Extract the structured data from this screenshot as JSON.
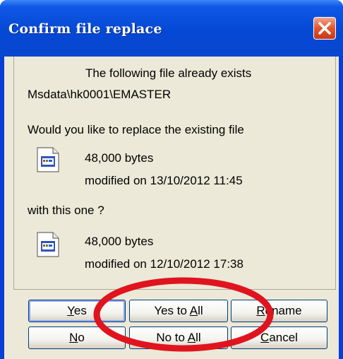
{
  "window": {
    "title": "Confirm file replace"
  },
  "message": {
    "line1": "The following file already exists",
    "path": "Msdata\\hk0001\\EMASTER",
    "question": "Would you like to replace the existing file",
    "with_label": "with this one ?"
  },
  "existing_file": {
    "size": "48,000 bytes",
    "modified": "modified on 13/10/2012 11:45"
  },
  "new_file": {
    "size": "48,000 bytes",
    "modified": "modified on 12/10/2012 17:38"
  },
  "buttons": {
    "yes": {
      "pre": "",
      "key": "Y",
      "post": "es"
    },
    "yes_to_all": {
      "pre": "Yes to ",
      "key": "A",
      "post": "ll"
    },
    "rename": {
      "pre": "",
      "key": "R",
      "post": "ename"
    },
    "no": {
      "pre": "",
      "key": "N",
      "post": "o"
    },
    "no_to_all": {
      "pre": "No to ",
      "key": "A",
      "post": "ll"
    },
    "cancel": {
      "pre": "",
      "key": "C",
      "post": "ancel"
    }
  },
  "annotation": {
    "color": "#e0141e"
  },
  "icons": {
    "close": "close-icon",
    "file": "file-document-icon"
  }
}
